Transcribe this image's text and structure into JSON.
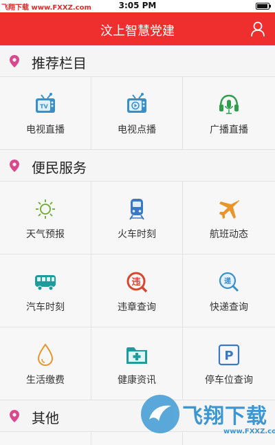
{
  "status_bar": {
    "watermark": "飞翔下载 www.FXXZ.com",
    "time": "3:05 PM"
  },
  "header": {
    "title": "汶上智慧党建"
  },
  "sections": [
    {
      "label": "推荐栏目",
      "items": [
        {
          "label": "电视直播",
          "icon": "tv-live-icon"
        },
        {
          "label": "电视点播",
          "icon": "tv-vod-icon"
        },
        {
          "label": "广播直播",
          "icon": "radio-headset-icon"
        }
      ]
    },
    {
      "label": "便民服务",
      "items": [
        {
          "label": "天气预报",
          "icon": "sun-icon"
        },
        {
          "label": "火车时刻",
          "icon": "train-icon"
        },
        {
          "label": "航班动态",
          "icon": "airplane-icon"
        },
        {
          "label": "汽车时刻",
          "icon": "bus-icon"
        },
        {
          "label": "违章查询",
          "icon": "violation-icon"
        },
        {
          "label": "快递查询",
          "icon": "express-icon"
        },
        {
          "label": "生活缴费",
          "icon": "water-drop-icon"
        },
        {
          "label": "健康资讯",
          "icon": "medical-folder-icon"
        },
        {
          "label": "停车位查询",
          "icon": "parking-icon"
        }
      ]
    },
    {
      "label": "其他",
      "items": []
    }
  ],
  "watermark_logo": {
    "brand": "飞翔下载",
    "url": "www.FXXZ.com"
  },
  "colors": {
    "header": "#ef2e2e",
    "pin": "#d94a8c"
  }
}
